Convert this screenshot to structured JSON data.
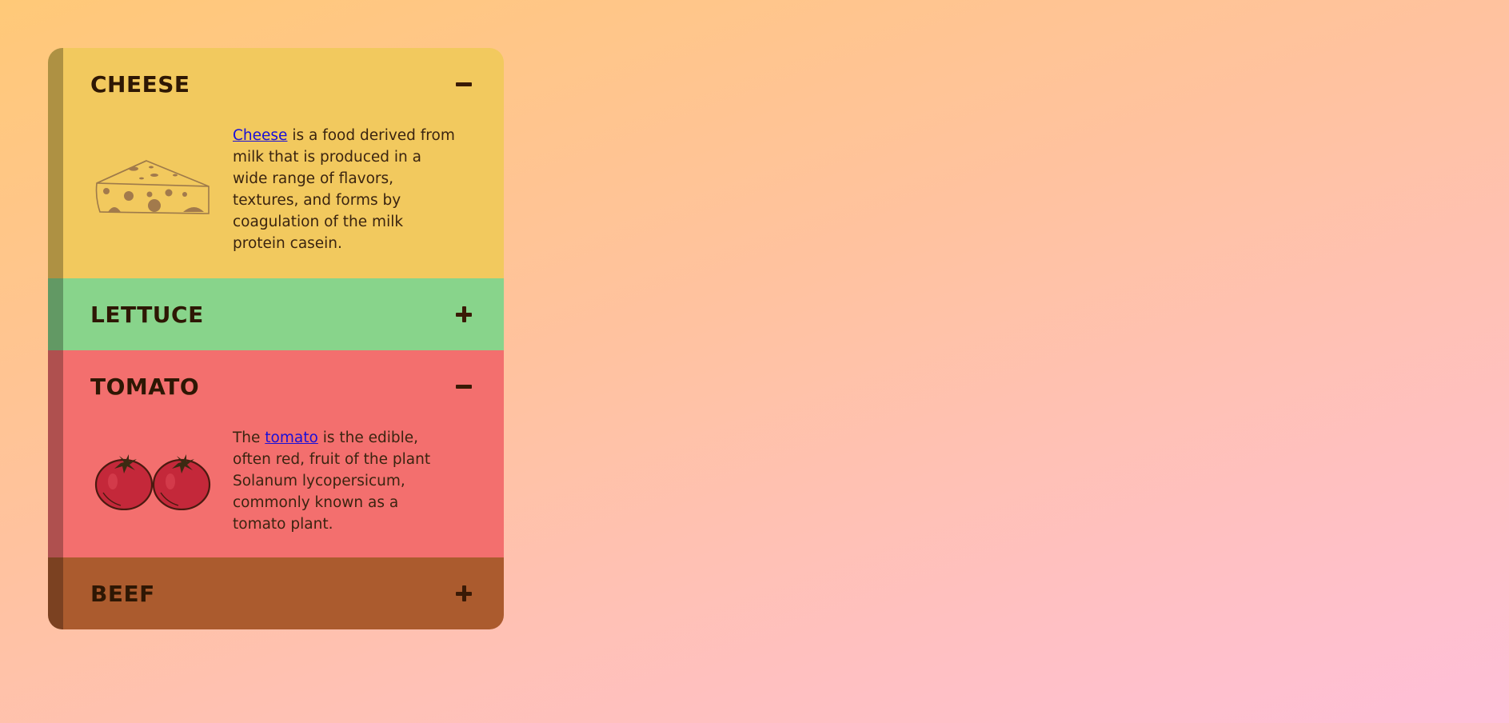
{
  "accordion": {
    "sections": [
      {
        "title": "CHEESE",
        "expanded": true,
        "toggle_symbol": "minus-icon",
        "color": "#f2c95e",
        "link_text": "Cheese",
        "text_before": "",
        "text_after": " is a food derived from milk that is produced in a wide range of flavors, textures, and forms by coagulation of the milk protein casein.",
        "image_icon": "cheese-icon"
      },
      {
        "title": "LETTUCE",
        "expanded": false,
        "toggle_symbol": "plus-icon",
        "color": "#88d48b"
      },
      {
        "title": "TOMATO",
        "expanded": true,
        "toggle_symbol": "minus-icon",
        "color": "#f36f6e",
        "link_text": "tomato",
        "text_before": "The ",
        "text_after": " is the edible, often red, fruit of the plant Solanum lycopersicum, commonly known as a tomato plant.",
        "image_icon": "tomatoes-icon"
      },
      {
        "title": "BEEF",
        "expanded": false,
        "toggle_symbol": "plus-icon",
        "color": "#ab5b2e"
      }
    ]
  }
}
